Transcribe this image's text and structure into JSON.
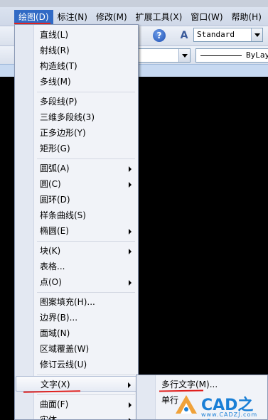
{
  "menubar": {
    "items": [
      {
        "label": "绘图(D)"
      },
      {
        "label": "标注(N)"
      },
      {
        "label": "修改(M)"
      },
      {
        "label": "扩展工具(X)"
      },
      {
        "label": "窗口(W)"
      },
      {
        "label": "帮助(H)"
      }
    ]
  },
  "toolbar": {
    "help_label": "?",
    "textstyle_label": "A",
    "text_style_value": "Standard",
    "linetype_value": "ByLay"
  },
  "draw_menu": {
    "items": [
      {
        "label": "直线(L)"
      },
      {
        "label": "射线(R)"
      },
      {
        "label": "构造线(T)"
      },
      {
        "label": "多线(M)"
      },
      {
        "label": "多段线(P)"
      },
      {
        "label": "三维多段线(3)"
      },
      {
        "label": "正多边形(Y)"
      },
      {
        "label": "矩形(G)"
      },
      {
        "label": "圆弧(A)"
      },
      {
        "label": "圆(C)"
      },
      {
        "label": "圆环(D)"
      },
      {
        "label": "样条曲线(S)"
      },
      {
        "label": "椭圆(E)"
      },
      {
        "label": "块(K)"
      },
      {
        "label": "表格..."
      },
      {
        "label": "点(O)"
      },
      {
        "label": "图案填充(H)..."
      },
      {
        "label": "边界(B)..."
      },
      {
        "label": "面域(N)"
      },
      {
        "label": "区域覆盖(W)"
      },
      {
        "label": "修订云线(U)"
      },
      {
        "label": "文字(X)"
      },
      {
        "label": "曲面(F)"
      },
      {
        "label": "实体"
      }
    ]
  },
  "text_submenu": {
    "items": [
      {
        "label": "多行文字(M)..."
      },
      {
        "label": "单行"
      }
    ]
  },
  "watermark": {
    "brand": "CAD之家",
    "url": "www.CADZJ.com"
  },
  "colors": {
    "menu_active": "#316ac5",
    "annotation_red": "#e0201e",
    "canvas": "#000000"
  }
}
